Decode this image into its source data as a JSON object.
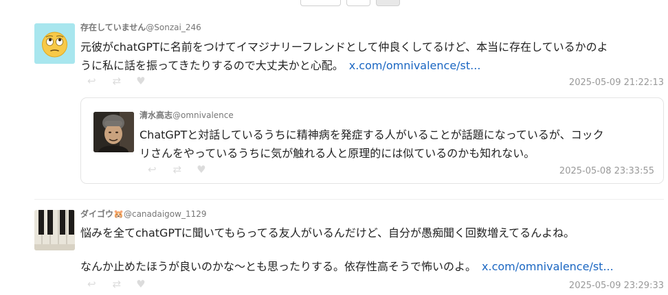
{
  "tweets": [
    {
      "author_name": "存在していません",
      "author_handle": "@Sonzai_246",
      "avatar_icon": "face-with-rolling-eyes-emoji",
      "text_line1": "元彼がchatGPTに名前をつけてイマジナリーフレンドとして仲良くしてるけど、本当に存在しているかのよ",
      "text_line2": "うに私に話を振ってきたりするので大丈夫かと心配。",
      "link": "x.com/omnivalence/st...",
      "timestamp": "2025-05-09 21:22:13",
      "quote": {
        "author_name": "清水高志",
        "author_handle": "@omnivalence",
        "avatar_icon": "person-photo",
        "text_line1": "ChatGPTと対話しているうちに精神病を発症する人がいることが話題になっているが、コック",
        "text_line2": "リさんをやっているうちに気が触れる人と原理的には似ているのかも知れない。",
        "timestamp": "2025-05-08 23:33:55"
      }
    },
    {
      "author_name": "ダイゴウ",
      "author_emoji": "🐹",
      "author_handle": "@canadaigow_1129",
      "avatar_icon": "piano-keys-photo",
      "text_line1": "悩みを全てchatGPTに聞いてもらってる友人がいるんだけど、自分が愚痴聞く回数増えてるんよね。",
      "text_line2": "なんか止めたほうが良いのかな〜とも思ったりする。依存性高そうで怖いのよ。",
      "link": "x.com/omnivalence/st...",
      "timestamp": "2025-05-09 23:29:33"
    }
  ],
  "action_icons": {
    "reply": "↩",
    "retweet": "⇄",
    "like": "♥"
  }
}
